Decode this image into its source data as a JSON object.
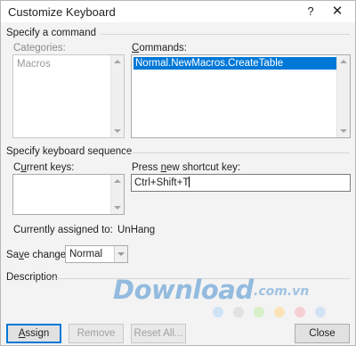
{
  "window": {
    "title": "Customize Keyboard",
    "help_label": "?",
    "close_label": "✕"
  },
  "specify_command": {
    "heading": "Specify a command",
    "categories_label": "Categories:",
    "categories": [
      "Macros"
    ],
    "commands_label": "Commands:",
    "commands": [
      "Normal.NewMacros.CreateTable"
    ]
  },
  "keyboard_sequence": {
    "heading": "Specify keyboard sequence",
    "current_keys_label": "Current keys:",
    "new_shortcut_label": "Press new shortcut key:",
    "new_shortcut_value": "Ctrl+Shift+T",
    "currently_assigned_label": "Currently assigned to:",
    "currently_assigned_value": "UnHang",
    "save_changes_label": "Save changes in:",
    "save_changes_value": "Normal"
  },
  "description": {
    "heading": "Description"
  },
  "buttons": {
    "assign": "Assign",
    "remove": "Remove",
    "reset_all": "Reset All...",
    "close": "Close"
  },
  "watermark": {
    "text": "Download",
    "domain": ".com.vn",
    "dot_colors": [
      "#cfe3f6",
      "#e1e1e1",
      "#d7f0c7",
      "#fbe3b7",
      "#f6cfd3",
      "#d4e2f7"
    ]
  },
  "colors": {
    "selection": "#0078d7",
    "dialog_bg": "#f3f3f3"
  }
}
